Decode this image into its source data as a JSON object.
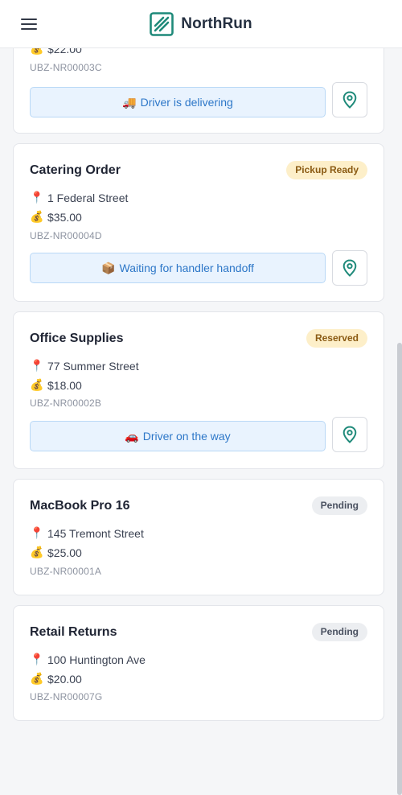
{
  "header": {
    "app_name": "NorthRun",
    "menu_icon": "hamburger-menu-icon",
    "logo_icon": "northrun-logo-icon"
  },
  "colors": {
    "brand": "#1f8a7a",
    "status_bg": "#e9f3fe",
    "status_text": "#2d77c8",
    "badge_warning_bg": "#fdefc9",
    "badge_pending_bg": "#eceef1"
  },
  "orders": [
    {
      "title": "",
      "badge": "",
      "address_icon": "📍",
      "address": "",
      "price_icon": "💰",
      "price": "$22.00",
      "order_id": "UBZ-NR00003C",
      "status_emoji": "🚚",
      "status": "Driver is delivering"
    },
    {
      "title": "Catering Order",
      "badge": "Pickup Ready",
      "address_icon": "📍",
      "address": "1 Federal Street",
      "price_icon": "💰",
      "price": "$35.00",
      "order_id": "UBZ-NR00004D",
      "status_emoji": "📦",
      "status": "Waiting for handler handoff"
    },
    {
      "title": "Office Supplies",
      "badge": "Reserved",
      "address_icon": "📍",
      "address": "77 Summer Street",
      "price_icon": "💰",
      "price": "$18.00",
      "order_id": "UBZ-NR00002B",
      "status_emoji": "🚗",
      "status": "Driver on the way"
    },
    {
      "title": "MacBook Pro 16",
      "badge": "Pending",
      "address_icon": "📍",
      "address": "145 Tremont Street",
      "price_icon": "💰",
      "price": "$25.00",
      "order_id": "UBZ-NR00001A"
    },
    {
      "title": "Retail Returns",
      "badge": "Pending",
      "address_icon": "📍",
      "address": "100 Huntington Ave",
      "price_icon": "💰",
      "price": "$20.00",
      "order_id": "UBZ-NR00007G"
    }
  ]
}
